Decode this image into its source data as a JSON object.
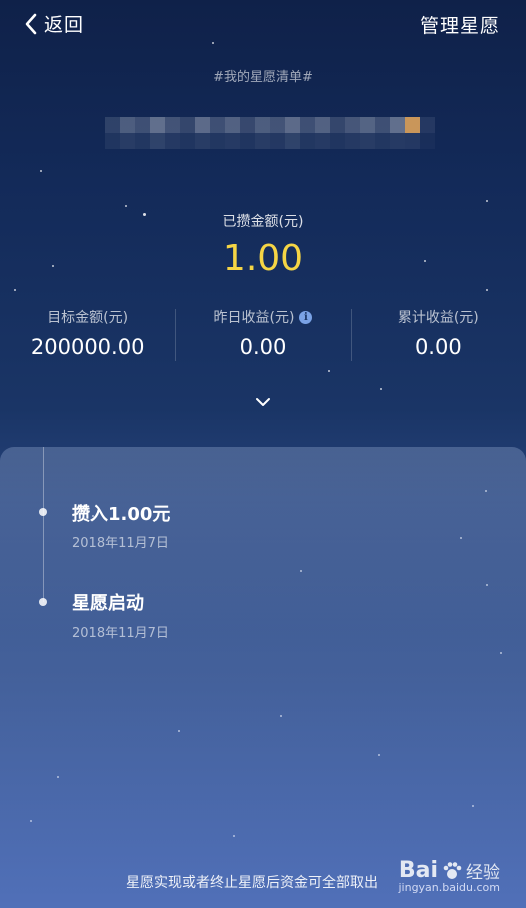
{
  "header": {
    "back_label": "返回",
    "manage_label": "管理星愿"
  },
  "wishlist": {
    "tag": "#我的星愿清单#",
    "saved_label": "已攒金额(元)",
    "saved_value": "1.00"
  },
  "stats": [
    {
      "label": "目标金额(元)",
      "value": "200000.00"
    },
    {
      "label": "昨日收益(元)",
      "value": "0.00",
      "info_icon": "info-icon"
    },
    {
      "label": "累计收益(元)",
      "value": "0.00"
    }
  ],
  "timeline": [
    {
      "title": "攒入1.00元",
      "date": "2018年11月7日"
    },
    {
      "title": "星愿启动",
      "date": "2018年11月7日"
    }
  ],
  "footer_note": "星愿实现或者终止星愿后资金可全部取出",
  "watermark": {
    "brand": "Bai",
    "brand_suffix": "经验",
    "url": "jingyan.baidu.com"
  },
  "colors": {
    "accent_gold": "#f5d545",
    "background_top": "#0f2149",
    "background_bottom": "#4d6db3"
  }
}
